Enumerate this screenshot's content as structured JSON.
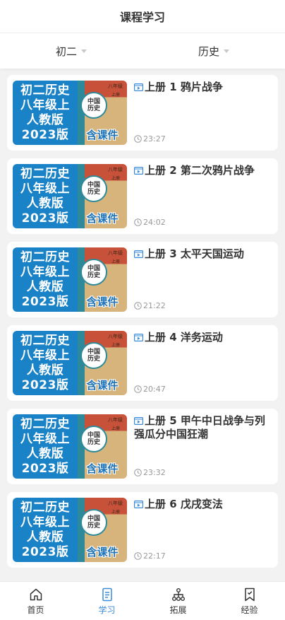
{
  "header": {
    "title": "课程学习"
  },
  "filters": [
    {
      "label": "初二"
    },
    {
      "label": "历史"
    }
  ],
  "thumbnail": {
    "lines": [
      "初二历史",
      "八年级上",
      "人教版",
      "2023版"
    ],
    "book_grade": "八年级",
    "book_volume": "上册",
    "book_title_1": "中国",
    "book_title_2": "历史",
    "book_footer": "含课件"
  },
  "courses": [
    {
      "title": "上册 1 鸦片战争",
      "duration": "23:27"
    },
    {
      "title": "上册 2 第二次鸦片战争",
      "duration": "24:02"
    },
    {
      "title": "上册 3 太平天国运动",
      "duration": "21:22"
    },
    {
      "title": "上册 4 洋务运动",
      "duration": "20:47"
    },
    {
      "title": "上册 5 甲午中日战争与列强瓜分中国狂潮",
      "duration": "23:32"
    },
    {
      "title": "上册 6 戊戌变法",
      "duration": "22:17"
    }
  ],
  "tabbar": [
    {
      "label": "首页",
      "icon": "home-icon"
    },
    {
      "label": "学习",
      "icon": "document-icon"
    },
    {
      "label": "拓展",
      "icon": "sitemap-icon"
    },
    {
      "label": "经验",
      "icon": "bookmark-icon"
    }
  ],
  "colors": {
    "accent": "#3b8bd9",
    "thumbnail_blue": "#1a82c7"
  }
}
